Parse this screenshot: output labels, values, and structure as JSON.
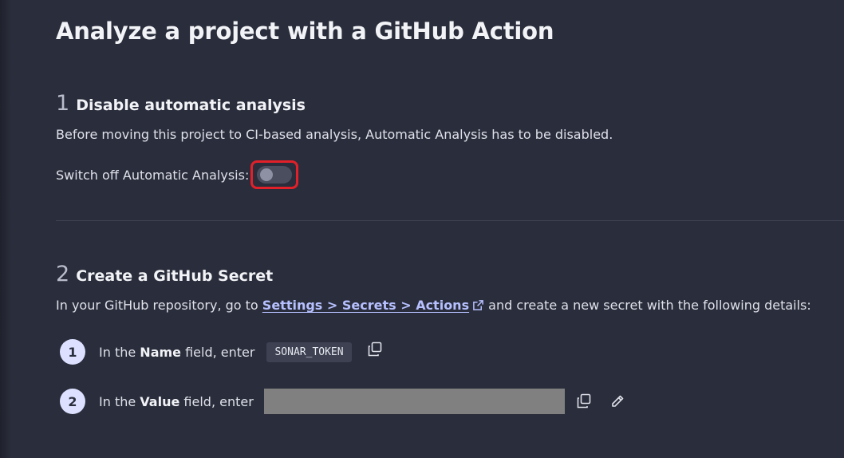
{
  "page": {
    "title": "Analyze a project with a GitHub Action"
  },
  "step1": {
    "number": "1",
    "title": "Disable automatic analysis",
    "description": "Before moving this project to CI-based analysis, Automatic Analysis has to be disabled.",
    "switch_label": "Switch off Automatic Analysis:",
    "switch_state": "off"
  },
  "step2": {
    "number": "2",
    "title": "Create a GitHub Secret",
    "intro_prefix": "In your GitHub repository, go to ",
    "link_text": "Settings > Secrets > Actions",
    "intro_suffix": " and create a new secret with the following details:",
    "items": [
      {
        "number": "1",
        "prefix": "In the ",
        "bold": "Name",
        "suffix": " field, enter",
        "value": "SONAR_TOKEN"
      },
      {
        "number": "2",
        "prefix": "In the ",
        "bold": "Value",
        "suffix": " field, enter",
        "value": ""
      }
    ]
  },
  "icons": {
    "copy": "copy-icon",
    "edit": "pencil-icon",
    "external": "external-link-icon"
  },
  "colors": {
    "background": "#2a2d3b",
    "link": "#b6c0ff",
    "highlight": "#e2202a",
    "step_circle": "#dde1ff"
  }
}
